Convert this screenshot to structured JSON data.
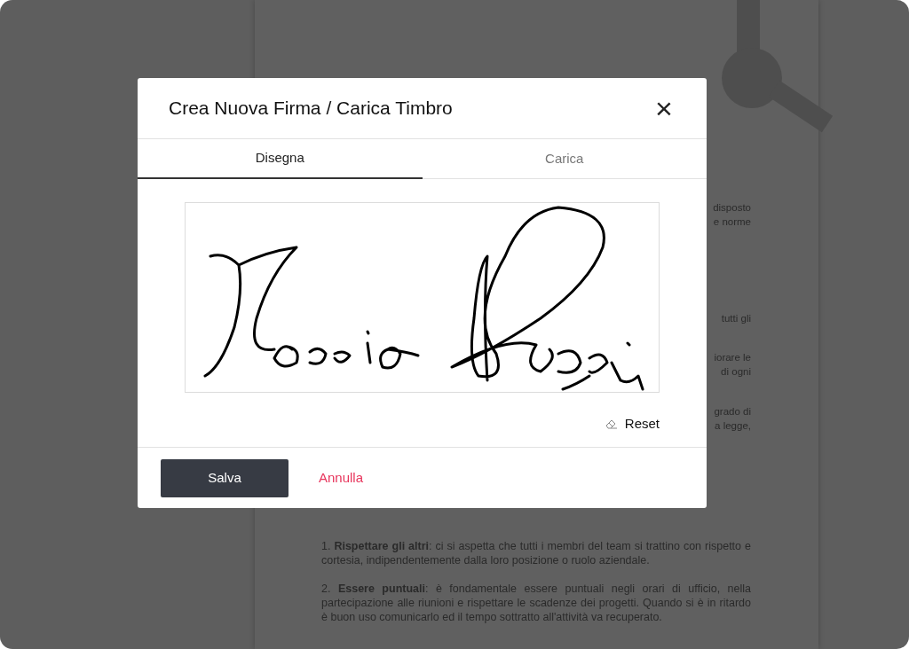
{
  "document": {
    "fragments": [
      "disposto",
      "e norme",
      "tutti gli",
      "iorare le",
      "di ogni",
      "grado di",
      "a legge,"
    ],
    "paragraphs": [
      "1. **Rispettare gli altri**: ci si aspetta che tutti i membri del team si trattino con rispetto e cortesia, indipendentemente dalla loro posizione o ruolo aziendale.",
      "2. **Essere puntuali**: è fondamentale essere puntuali negli orari di ufficio, nella partecipazione alle riunioni e rispettare le scadenze dei progetti. Quando si è in ritardo è buon uso comunicarlo ed il tempo sottratto all'attività va recuperato."
    ]
  },
  "dialog": {
    "title": "Crea Nuova Firma / Carica Timbro",
    "close": "×",
    "tabs": [
      {
        "label": "Disegna",
        "selected": true
      },
      {
        "label": "Carica",
        "selected": false
      }
    ],
    "reset": "Reset",
    "buttons": [
      {
        "kind": "primary",
        "label": "Salva"
      },
      {
        "kind": "cancel",
        "label": "Annulla"
      }
    ]
  }
}
